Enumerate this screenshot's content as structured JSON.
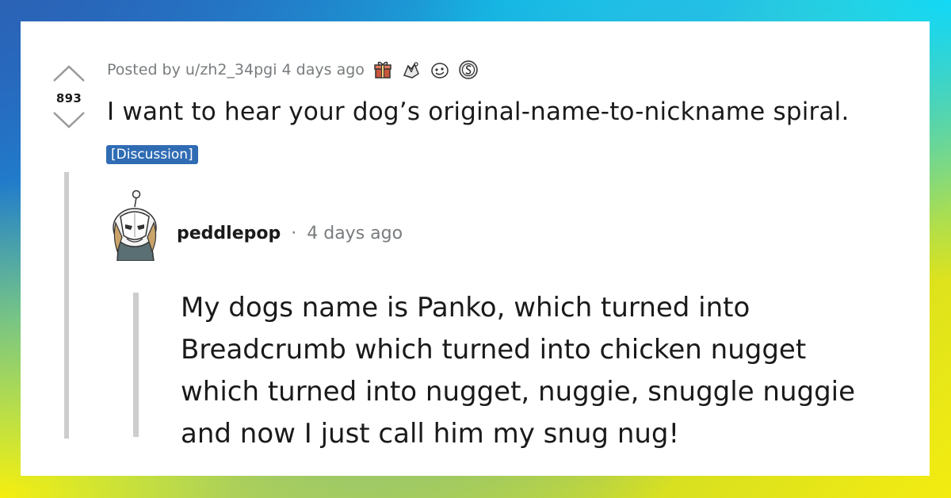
{
  "post": {
    "score": "893",
    "posted_by": "Posted by u/zh2_34pgi 4 days ago",
    "title": "I want to hear your dog’s original-name-to-nickname spiral.",
    "flair": "[Discussion]",
    "awards": [
      "gift-award-icon",
      "hands-award-icon",
      "face-award-icon",
      "silver-award-icon"
    ]
  },
  "comment": {
    "username": "peddlepop",
    "separator": "·",
    "time": "4 days ago",
    "body_lines": [
      "My dogs name is Panko, which turned into",
      "Breadcrumb which turned into chicken nugget",
      "which turned into nugget, nuggie, snuggle nuggie",
      "and now I just call him my snug nug!"
    ]
  },
  "colors": {
    "text": "#1a1a1b",
    "meta": "#787c7e",
    "flair_bg": "#2f6cb4",
    "thread_line": "#cdcdcd"
  }
}
